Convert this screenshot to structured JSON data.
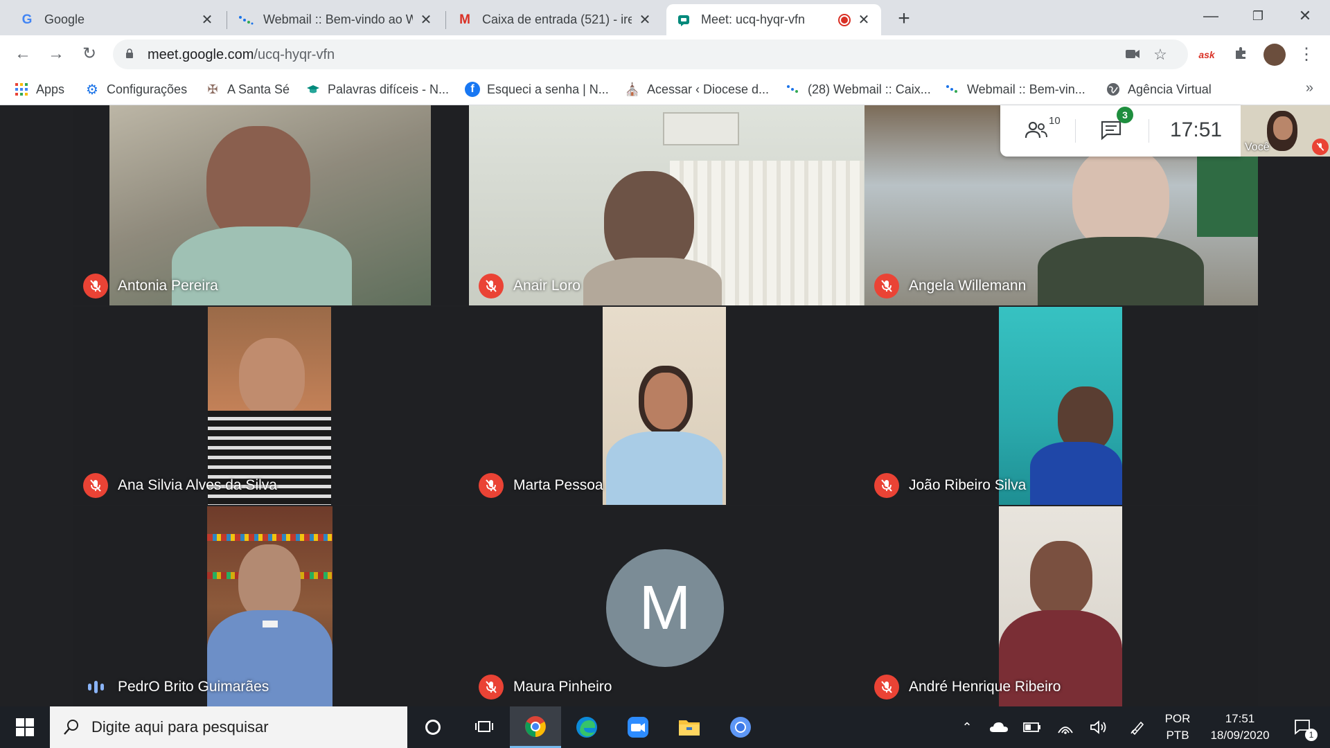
{
  "browser": {
    "tabs": [
      {
        "title": "Google",
        "icon": "google-icon"
      },
      {
        "title": "Webmail :: Bem-vindo ao W",
        "icon": "webmail-icon"
      },
      {
        "title": "Caixa de entrada (521) - irer",
        "icon": "gmail-icon"
      },
      {
        "title": "Meet: ucq-hyqr-vfn",
        "icon": "meet-icon",
        "active": true,
        "recording": true
      }
    ],
    "url_host": "meet.google.com",
    "url_path": "/ucq-hyqr-vfn",
    "bookmarks": [
      {
        "label": "Apps",
        "icon": "apps-grid-icon"
      },
      {
        "label": "Configurações",
        "icon": "gear-icon"
      },
      {
        "label": "A Santa Sé",
        "icon": "vatican-icon"
      },
      {
        "label": "Palavras difíceis - N...",
        "icon": "cap-icon"
      },
      {
        "label": "Esqueci a senha | N...",
        "icon": "facebook-icon"
      },
      {
        "label": "Acessar ‹ Diocese d...",
        "icon": "diocese-icon"
      },
      {
        "label": "(28) Webmail :: Caix...",
        "icon": "webmail-icon"
      },
      {
        "label": "Webmail :: Bem-vin...",
        "icon": "webmail-icon"
      },
      {
        "label": "Agência Virtual",
        "icon": "globe-icon"
      }
    ],
    "bookmarks_more": "»"
  },
  "meet": {
    "participant_count": "10",
    "chat_badge": "3",
    "time": "17:51",
    "self_label": "Você",
    "participants": [
      {
        "name": "Antonia Pereira",
        "muted": true
      },
      {
        "name": "Anair Loro",
        "muted": true
      },
      {
        "name": "Angela Willemann",
        "muted": true
      },
      {
        "name": "Ana Silvia Alves da Silva",
        "muted": true
      },
      {
        "name": "Marta Pessoa",
        "muted": true
      },
      {
        "name": "João Ribeiro Silva",
        "muted": true
      },
      {
        "name": "PedrO Brito Guimarães",
        "muted": false,
        "speaking": true
      },
      {
        "name": "Maura Pinheiro",
        "muted": true,
        "avatar_letter": "M"
      },
      {
        "name": "André Henrique Ribeiro",
        "muted": true
      }
    ]
  },
  "taskbar": {
    "search_placeholder": "Digite aqui para pesquisar",
    "lang_top": "POR",
    "lang_bottom": "PTB",
    "clock_time": "17:51",
    "clock_date": "18/09/2020",
    "notification_count": "1"
  },
  "colors": {
    "mute_red": "#ea4335",
    "meet_bg": "#202124",
    "chrome_strip": "#dee1e6",
    "badge_green": "#1e8e3e",
    "speaking_blue": "#8ab4f8"
  }
}
